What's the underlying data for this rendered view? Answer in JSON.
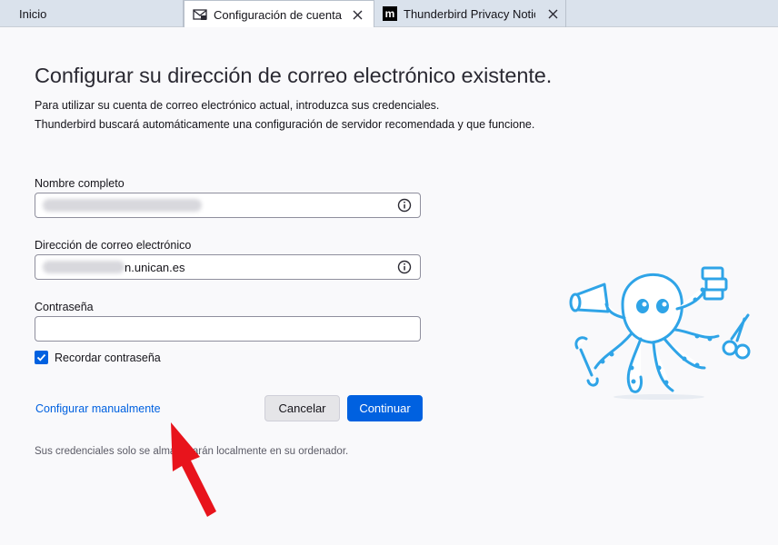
{
  "tabs": [
    {
      "label": "Inicio",
      "active": false
    },
    {
      "label": "Configuración de cuenta",
      "active": true,
      "icon": "mail-icon"
    },
    {
      "label": "Thunderbird Privacy Notice",
      "active": false,
      "icon": "mozilla-icon"
    }
  ],
  "page": {
    "title": "Configurar su dirección de correo electrónico existente.",
    "description_line1": "Para utilizar su cuenta de correo electrónico actual, introduzca sus credenciales.",
    "description_line2": "Thunderbird buscará automáticamente una configuración de servidor recomendada y que funcione."
  },
  "form": {
    "name_label": "Nombre completo",
    "name_value": "",
    "email_label": "Dirección de correo electrónico",
    "email_value_visible": "n.unican.es",
    "password_label": "Contraseña",
    "password_value": "",
    "remember_label": "Recordar contraseña",
    "remember_checked": true
  },
  "actions": {
    "manual_link": "Configurar manualmente",
    "cancel": "Cancelar",
    "continue": "Continuar"
  },
  "footer_note": "Sus credenciales solo se almacenarán localmente en su ordenador.",
  "colors": {
    "accent": "#0061e0",
    "tabbar": "#dae2ec",
    "background": "#f9f9fb",
    "mascot": "#2fa4e7",
    "arrow": "#e8141c"
  }
}
